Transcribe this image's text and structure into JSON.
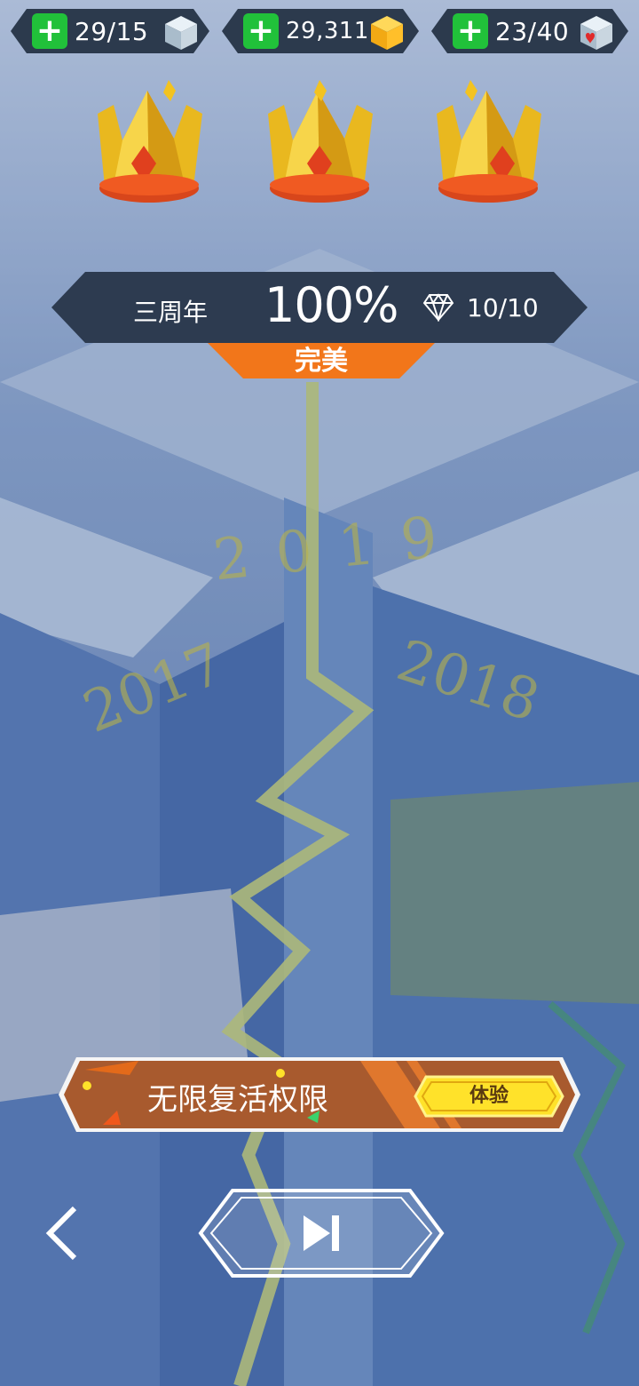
{
  "resources": [
    {
      "name": "stamina",
      "value": "29/15",
      "icon": "silver-cube-icon"
    },
    {
      "name": "coins",
      "value": "29,311",
      "icon": "gold-cube-icon"
    },
    {
      "name": "hearts",
      "value": "23/40",
      "icon": "heart-cube-icon"
    }
  ],
  "result": {
    "crowns_earned": 3,
    "level_name": "三周年",
    "percent": "100%",
    "gems": "10/10",
    "rating": "完美"
  },
  "background_years": [
    "2019",
    "2017",
    "2018"
  ],
  "promo": {
    "title": "无限复活权限",
    "button": "体验"
  },
  "colors": {
    "plus_green": "#21c13a",
    "banner_dark": "#2d3b50",
    "perfect_orange": "#f2761a",
    "promo_brown": "#a85a2e",
    "try_yellow": "#ffe22a"
  }
}
